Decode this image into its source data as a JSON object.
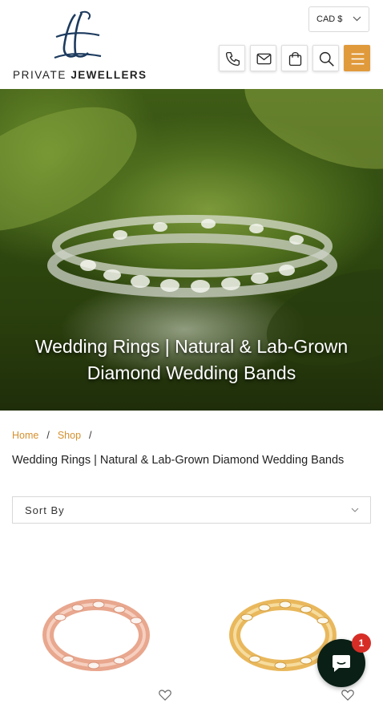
{
  "brand": {
    "name_light": "PRIVATE",
    "name_bold": "JEWELLERS",
    "accent": "#e09a3c",
    "link_color": "#d4902f"
  },
  "header": {
    "currency": "CAD $",
    "icons": [
      "phone-icon",
      "mail-icon",
      "cart-icon",
      "search-icon",
      "menu-icon"
    ]
  },
  "hero": {
    "title": "Wedding Rings | Natural & Lab-Grown Diamond Wedding Bands"
  },
  "breadcrumb": {
    "home": "Home",
    "shop": "Shop",
    "separator": "/"
  },
  "page": {
    "title": "Wedding Rings | Natural & Lab-Grown Diamond Wedding Bands"
  },
  "sort": {
    "label": "Sort By"
  },
  "products": [
    {
      "metal": "rose gold",
      "color": "#e8a78e",
      "icon": "heart-outline-icon"
    },
    {
      "metal": "yellow gold",
      "color": "#e9b85c",
      "icon": "heart-outline-icon"
    }
  ],
  "chat": {
    "badge": "1"
  }
}
